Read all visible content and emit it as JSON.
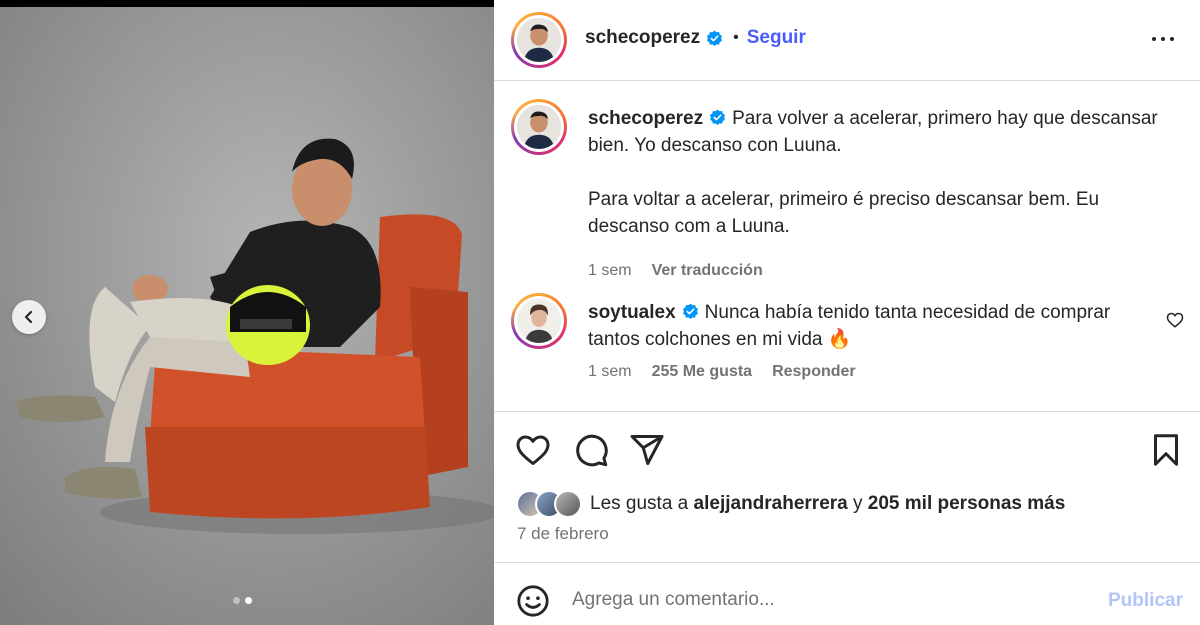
{
  "post": {
    "author": "schecoperez",
    "follow_label": "Seguir",
    "separator": "•",
    "more_icon": "more-options-icon"
  },
  "caption": {
    "username": "schecoperez",
    "text_es": "Para volver a acelerar, primero hay que descansar bien. Yo descanso con Luuna.",
    "text_pt": "Para voltar a acelerar, primeiro é preciso descansar bem. Eu descanso com a Luuna.",
    "time": "1 sem",
    "translate_label": "Ver traducción"
  },
  "comment": {
    "username": "soytualex",
    "text": "Nunca había tenido tanta necesidad de comprar tantos colchones en mi vida 🔥",
    "time": "1 sem",
    "likes": "255 Me gusta",
    "reply_label": "Responder"
  },
  "likes": {
    "prefix": "Les gusta a ",
    "first_user": "alejjandraherrera",
    "connector": " y ",
    "others": "205 mil personas más"
  },
  "date": "7 de febrero",
  "composer": {
    "placeholder": "Agrega un comentario...",
    "publish_label": "Publicar"
  },
  "carousel": {
    "total": 2,
    "active_index": 1
  },
  "colors": {
    "link_blue": "#4a5df9",
    "publish_disabled": "#b3c4f9",
    "sofa": "#c94a24",
    "verified": "#0095f6"
  }
}
